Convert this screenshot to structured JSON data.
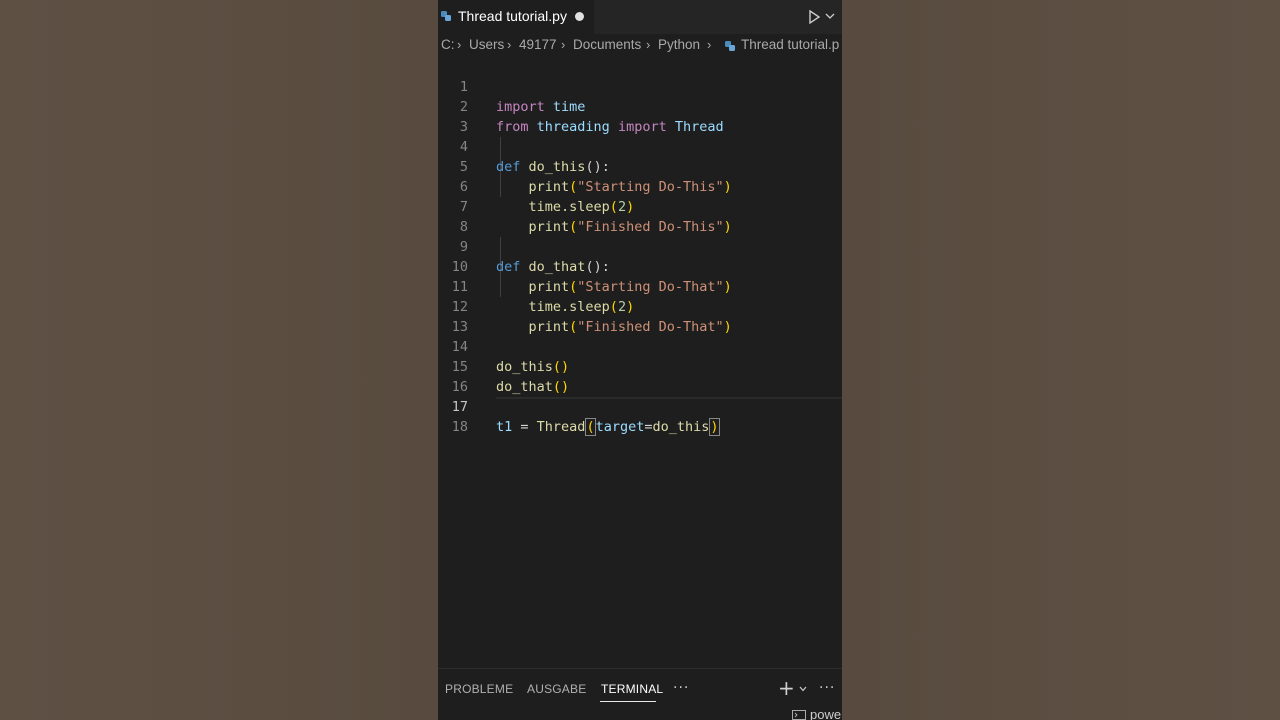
{
  "tab": {
    "title": "Thread tutorial.py"
  },
  "breadcrumb": [
    "C:",
    "Users",
    "49177",
    "Documents",
    "Python",
    "Thread tutorial.p"
  ],
  "editor": {
    "lines": [
      {
        "n": "1"
      },
      {
        "n": "2"
      },
      {
        "n": "3"
      },
      {
        "n": "4"
      },
      {
        "n": "5"
      },
      {
        "n": "6"
      },
      {
        "n": "7"
      },
      {
        "n": "8"
      },
      {
        "n": "9"
      },
      {
        "n": "10"
      },
      {
        "n": "11"
      },
      {
        "n": "12"
      },
      {
        "n": "13"
      },
      {
        "n": "14"
      },
      {
        "n": "15"
      },
      {
        "n": "16"
      },
      {
        "n": "17"
      },
      {
        "n": "18"
      }
    ],
    "tokens": {
      "import": "import",
      "time": "time",
      "from": "from",
      "threading": "threading",
      "Thread": "Thread",
      "def": "def",
      "do_this": "do_this",
      "do_that": "do_that",
      "call_parens": "():",
      "print": "print",
      "lp": "(",
      "rp": ")",
      "s1": "\"Starting Do-This\"",
      "s2": "\"Finished Do-This\"",
      "s3": "\"Starting Do-That\"",
      "s4": "\"Finished Do-That\"",
      "time_sleep": "time.sleep",
      "two": "2",
      "empty_call": "()",
      "t1": "t1",
      "eq": " = ",
      "target": "target",
      "assign": "="
    }
  },
  "panel": {
    "tabs": [
      "PROBLEME",
      "AUSGABE",
      "TERMINAL"
    ],
    "more": "···",
    "terminal_label": "powe"
  }
}
